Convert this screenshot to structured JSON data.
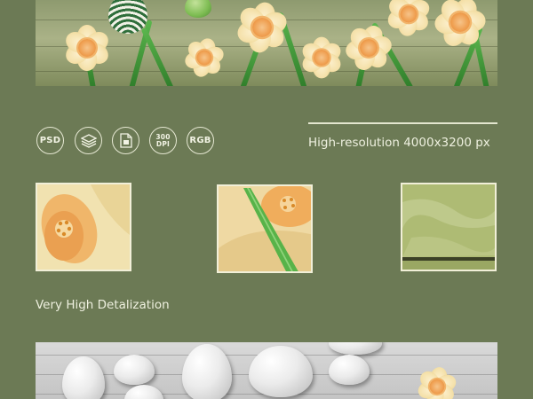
{
  "format_icons": [
    {
      "name": "psd-icon",
      "label": "PSD"
    },
    {
      "name": "layers-icon",
      "label": ""
    },
    {
      "name": "file-icon",
      "label": ""
    },
    {
      "name": "dpi-icon",
      "label": "300 DPI"
    },
    {
      "name": "rgb-icon",
      "label": "RGB"
    }
  ],
  "resolution_text": "High-resolution 4000x3200 px",
  "detail_text": "Very High Detalization",
  "colors": {
    "background": "#6c7a55",
    "text": "#eef0df",
    "accent_green": "#4ea843",
    "petal": "#f4e0a8",
    "flower_center": "#ef9e4f"
  }
}
